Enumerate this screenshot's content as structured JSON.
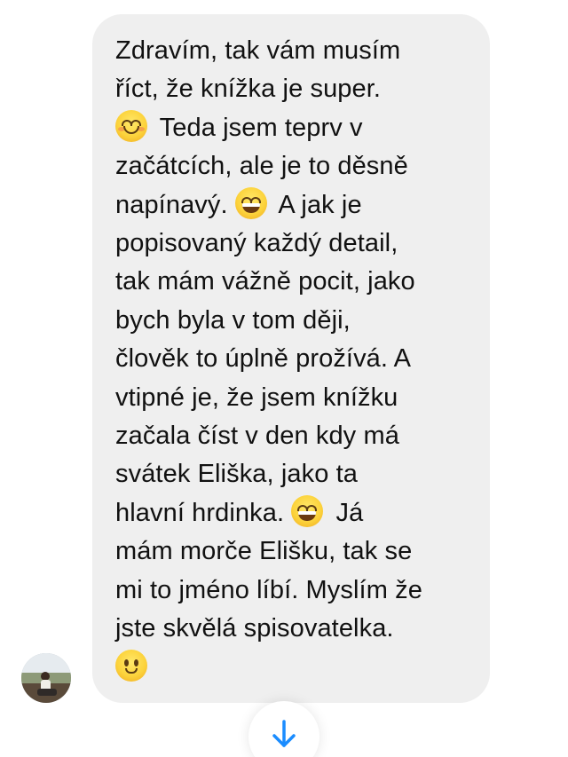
{
  "message": {
    "lines": [
      {
        "text": "Zdravím, tak vám musím",
        "emoji": null
      },
      {
        "text": "říct, že knížka je super.",
        "emoji": null
      },
      {
        "text": "Teda jsem teprv v",
        "emoji": "smiling-face-icon"
      },
      {
        "text": "začátcích, ale je to děsně",
        "emoji": null
      },
      {
        "text": "napínavý.",
        "emoji": null,
        "emoji_after": "grinning-face-icon",
        "text_after": "A jak je"
      },
      {
        "text": "popisovaný každý detail,",
        "emoji": null
      },
      {
        "text": "tak mám vážně pocit, jako",
        "emoji": null
      },
      {
        "text": "bych byla v tom ději,",
        "emoji": null
      },
      {
        "text": "člověk to úplně prožívá. A",
        "emoji": null
      },
      {
        "text": "vtipné je, že jsem knížku",
        "emoji": null
      },
      {
        "text": "začala číst v den kdy má",
        "emoji": null
      },
      {
        "text": "svátek Eliška, jako ta",
        "emoji": null
      },
      {
        "text": "hlavní hrdinka.",
        "emoji": null,
        "emoji_after": "grinning-face-icon",
        "text_after": "Já"
      },
      {
        "text": "mám morče Elišku, tak se",
        "emoji": null
      },
      {
        "text": "mi to jméno líbí. Myslím že",
        "emoji": null
      },
      {
        "text": "jste skvělá spisovatelka.",
        "emoji": null
      },
      {
        "text": "",
        "emoji": "slightly-smiling-face-icon"
      }
    ]
  },
  "colors": {
    "bubble_background": "#efefef",
    "text": "#111111",
    "accent": "#1a8cff"
  },
  "icons": {
    "scroll_down": "arrow-down-icon",
    "avatar": "user-avatar"
  }
}
